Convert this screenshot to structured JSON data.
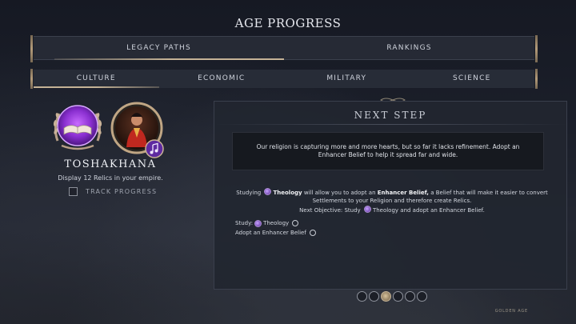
{
  "header": {
    "title": "AGE PROGRESS"
  },
  "top_tabs": [
    {
      "label": "LEGACY PATHS",
      "active": true
    },
    {
      "label": "RANKINGS",
      "active": false
    }
  ],
  "sub_tabs": [
    {
      "label": "CULTURE",
      "active": true
    },
    {
      "label": "ECONOMIC",
      "active": false
    },
    {
      "label": "MILITARY",
      "active": false
    },
    {
      "label": "SCIENCE",
      "active": false
    }
  ],
  "legacy": {
    "name": "TOSHAKHANA",
    "description": "Display 12 Relics in your empire.",
    "track_label": "TRACK PROGRESS",
    "track_checked": false,
    "icon": "open-book-icon",
    "leader_icon": "leader-portrait-icon",
    "badge_icon": "music-note-icon"
  },
  "panel": {
    "title": "NEXT STEP",
    "quote": "Our religion is capturing more and more hearts, but so far it lacks refinement. Adopt an Enhancer Belief to help it spread far and wide.",
    "study": {
      "prefix": "Studying",
      "tech": "Theology",
      "middle": "will allow you to adopt an",
      "belief": "Enhancer Belief,",
      "suffix": "a Belief that will make it easier to convert Settlements to your Religion and therefore create Relics."
    },
    "next_objective": {
      "prefix": "Next Objective: Study",
      "suffix": "Theology and adopt an Enhancer Belief."
    },
    "objectives": [
      {
        "prefix": "Study:",
        "tech": "Theology",
        "done": false
      },
      {
        "label": "Adopt an Enhancer Belief",
        "done": false
      }
    ]
  },
  "pager": {
    "count": 6,
    "active_index": 2
  },
  "footer": {
    "age_label": "GOLDEN AGE"
  },
  "colors": {
    "accent_gold": "#c5b396",
    "purple": "#8a3fd1",
    "panel_bg": "#222630"
  }
}
